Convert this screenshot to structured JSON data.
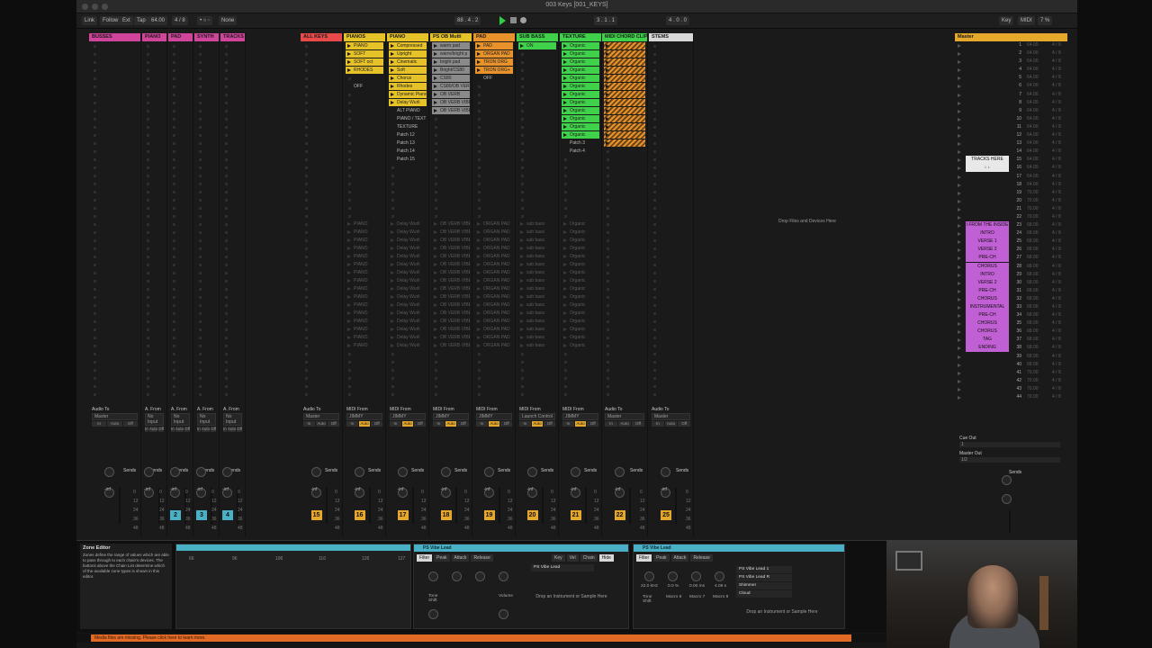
{
  "window": {
    "title": "003 Keys  [001_KEYS]"
  },
  "controlbar": {
    "left_items": [
      "Link",
      "Follow",
      "Ext",
      "Tap",
      "64.00",
      "4 / 8",
      "• ○ ◦",
      "None"
    ],
    "position": "88 . 4 . 2",
    "loop_start": "3 . 1 . 1",
    "loop_len": "4 . 0 . 0",
    "right_items": [
      "Key",
      "MIDI",
      "7 %"
    ]
  },
  "tracks": [
    {
      "name": "BUSSES",
      "color": "#d1449c",
      "num": "",
      "io_label": "Audio To",
      "io_value": "Master",
      "clips": []
    },
    {
      "name": "PIANO",
      "color": "#d1449c",
      "num": "",
      "io_label": "A. From",
      "io_value": "No Input",
      "clips": []
    },
    {
      "name": "PAD",
      "color": "#d1449c",
      "num": "2",
      "io_label": "A. From",
      "io_value": "No Input",
      "clips": []
    },
    {
      "name": "SYNTH",
      "color": "#d1449c",
      "num": "3",
      "io_label": "A. From",
      "io_value": "No Input",
      "clips": []
    },
    {
      "name": "TRACKS",
      "color": "#d1449c",
      "num": "4",
      "io_label": "A. From",
      "io_value": "No Input",
      "clips": []
    },
    {
      "name": "ALL KEYS",
      "color": "#e84a4a",
      "num": "15",
      "io_label": "Audio To",
      "io_value": "Master",
      "clips": []
    },
    {
      "name": "PIANOS",
      "color": "#e6c229",
      "num": "16",
      "io_label": "MIDI From",
      "io_value": "JIMMY",
      "clips": [
        "PIANO",
        "SOFT",
        "SOFT oct",
        "RHODES",
        "",
        "OFF"
      ]
    },
    {
      "name": "PIANO",
      "color": "#e6c229",
      "num": "17",
      "io_label": "MIDI From",
      "io_value": "JIMMY",
      "clips": [
        "Compressed",
        "Upright",
        "Cinematic",
        "Soft",
        "Chorus",
        "Rhodes",
        "Dynamic Piano",
        "Delay Wurli",
        "ALT PIANO",
        "PIANO / TEXT",
        "TEXTURE",
        "Patch 12",
        "Patch 13",
        "Patch 14",
        "Patch 15"
      ]
    },
    {
      "name": "PS OB Multi",
      "color": "#e6c229",
      "num": "18",
      "io_label": "MIDI From",
      "io_value": "JIMMY",
      "clips": [
        "warm pad",
        "warm/bright p",
        "bright pad",
        "Bright/CS80",
        "CS80",
        "CS80/OB VERB",
        "OB VERB",
        "OB VERB VIBE L",
        "OB VERB VIBE L"
      ]
    },
    {
      "name": "PAD",
      "color": "#e8922b",
      "num": "19",
      "io_label": "MIDI From",
      "io_value": "JIMMY",
      "clips": [
        "PAD",
        "ORGAN PAD",
        "TRON ORG",
        "TRON ORG+",
        "OFF"
      ]
    },
    {
      "name": "SUB BASS",
      "color": "#3fd14a",
      "num": "20",
      "io_label": "MIDI From",
      "io_value": "Launch Control",
      "clips": [
        "ON"
      ]
    },
    {
      "name": "TEXTURE",
      "color": "#3fd14a",
      "num": "21",
      "io_label": "MIDI From",
      "io_value": "JIMMY",
      "clips": [
        "Organic",
        "Organic",
        "Organic",
        "Organic",
        "Organic",
        "Organic",
        "Organic",
        "Organic",
        "Organic",
        "Organic",
        "Organic",
        "Organic",
        "Patch 3",
        "Patch 4"
      ]
    },
    {
      "name": "MIDI CHORD CLIPS",
      "color": "#3fd14a",
      "num": "22",
      "io_label": "Audio To",
      "io_value": "Master",
      "clips": [
        "",
        "",
        "",
        "",
        "",
        "",
        "",
        "",
        "",
        "",
        "",
        "",
        ""
      ]
    },
    {
      "name": "STEMS",
      "color": "#d7d7d7",
      "num": "25",
      "io_label": "Audio To",
      "io_value": "Master",
      "clips": []
    }
  ],
  "ghost_clips": [
    "PIANO",
    "Delay Wurli",
    "OB VERB VIBE L",
    "ORGAN PAD",
    "sub bass",
    "Organic"
  ],
  "master": {
    "header": "Master",
    "scenes": [
      {
        "name": "",
        "num": "1",
        "tempo": "64.00",
        "sig": "4 / 8"
      },
      {
        "name": "",
        "num": "2",
        "tempo": "64.00",
        "sig": "4 / 8"
      },
      {
        "name": "",
        "num": "3",
        "tempo": "64.00",
        "sig": "4 / 8"
      },
      {
        "name": "",
        "num": "4",
        "tempo": "64.00",
        "sig": "4 / 8"
      },
      {
        "name": "",
        "num": "5",
        "tempo": "64.00",
        "sig": "4 / 8"
      },
      {
        "name": "",
        "num": "6",
        "tempo": "64.00",
        "sig": "4 / 8"
      },
      {
        "name": "",
        "num": "7",
        "tempo": "64.00",
        "sig": "4 / 8"
      },
      {
        "name": "",
        "num": "8",
        "tempo": "64.00",
        "sig": "4 / 8"
      },
      {
        "name": "",
        "num": "9",
        "tempo": "64.00",
        "sig": "4 / 8"
      },
      {
        "name": "",
        "num": "10",
        "tempo": "64.00",
        "sig": "4 / 8"
      },
      {
        "name": "",
        "num": "11",
        "tempo": "64.00",
        "sig": "4 / 8"
      },
      {
        "name": "",
        "num": "12",
        "tempo": "64.00",
        "sig": "4 / 8"
      },
      {
        "name": "",
        "num": "13",
        "tempo": "64.00",
        "sig": "4 / 8"
      },
      {
        "name": "",
        "num": "14",
        "tempo": "64.00",
        "sig": "4 / 8"
      },
      {
        "name": "TRACKS HERE",
        "num": "15",
        "tempo": "64.00",
        "sig": "4 / 8"
      },
      {
        "name": "↓ ↓",
        "num": "16",
        "tempo": "64.00",
        "sig": "4 / 8"
      },
      {
        "name": "",
        "num": "17",
        "tempo": "64.00",
        "sig": "4 / 8"
      },
      {
        "name": "",
        "num": "18",
        "tempo": "64.00",
        "sig": "4 / 8"
      },
      {
        "name": "",
        "num": "19",
        "tempo": "70.00",
        "sig": "4 / 8"
      },
      {
        "name": "",
        "num": "20",
        "tempo": "70.00",
        "sig": "4 / 8"
      },
      {
        "name": "",
        "num": "21",
        "tempo": "70.00",
        "sig": "4 / 8"
      },
      {
        "name": "",
        "num": "22",
        "tempo": "70.00",
        "sig": "4 / 8"
      },
      {
        "name": "I FROM THE INSIDE O",
        "num": "23",
        "tempo": "68.00",
        "sig": "4 / 8"
      },
      {
        "name": "INTRO",
        "num": "24",
        "tempo": "68.00",
        "sig": "4 / 8"
      },
      {
        "name": "VERSE 1",
        "num": "25",
        "tempo": "68.00",
        "sig": "4 / 8"
      },
      {
        "name": "VERSE 2",
        "num": "26",
        "tempo": "68.00",
        "sig": "4 / 8"
      },
      {
        "name": "PRE-CH",
        "num": "27",
        "tempo": "68.00",
        "sig": "4 / 8"
      },
      {
        "name": "CHORUS",
        "num": "28",
        "tempo": "68.00",
        "sig": "4 / 8"
      },
      {
        "name": "INTRO",
        "num": "29",
        "tempo": "68.00",
        "sig": "4 / 8"
      },
      {
        "name": "VERSE 2",
        "num": "30",
        "tempo": "68.00",
        "sig": "4 / 8"
      },
      {
        "name": "PRE-CH",
        "num": "31",
        "tempo": "68.00",
        "sig": "4 / 8"
      },
      {
        "name": "CHORUS",
        "num": "32",
        "tempo": "68.00",
        "sig": "4 / 8"
      },
      {
        "name": "INSTRUMENTAL",
        "num": "33",
        "tempo": "68.00",
        "sig": "4 / 8"
      },
      {
        "name": "PRE-CH",
        "num": "34",
        "tempo": "68.00",
        "sig": "4 / 8"
      },
      {
        "name": "CHORUS",
        "num": "35",
        "tempo": "68.00",
        "sig": "4 / 8"
      },
      {
        "name": "CHORUS",
        "num": "36",
        "tempo": "68.00",
        "sig": "4 / 8"
      },
      {
        "name": "TAG",
        "num": "37",
        "tempo": "68.00",
        "sig": "4 / 8"
      },
      {
        "name": "ENDING",
        "num": "38",
        "tempo": "68.00",
        "sig": "4 / 8"
      },
      {
        "name": "",
        "num": "39",
        "tempo": "68.00",
        "sig": "4 / 8"
      },
      {
        "name": "",
        "num": "40",
        "tempo": "68.00",
        "sig": "4 / 8"
      },
      {
        "name": "",
        "num": "41",
        "tempo": "70.00",
        "sig": "4 / 8"
      },
      {
        "name": "",
        "num": "42",
        "tempo": "70.00",
        "sig": "4 / 8"
      },
      {
        "name": "",
        "num": "43",
        "tempo": "70.00",
        "sig": "4 / 8"
      },
      {
        "name": "",
        "num": "44",
        "tempo": "70.00",
        "sig": "4 / 8"
      }
    ],
    "cue_out_label": "Cue Out",
    "cue_out_value": "1",
    "master_out_label": "Master Out",
    "master_out_value": "1/2",
    "sends": "Sends"
  },
  "drop_hint": "Drop Files and Devices Here",
  "sends_label": "Sends",
  "fader_value": "-inf",
  "zone_editor": {
    "title": "Zone Editor",
    "text": "Zones define the range of values which are able to pass through to each chain's devices. The buttons above the Chain List determine which of the available zone types is shown in this editor.",
    "ruler": [
      "66",
      "96",
      "106",
      "116",
      "126",
      "127"
    ]
  },
  "device1": {
    "title": "PS Vibe Lead",
    "tabs": [
      "Filter",
      "Peak",
      "Attack",
      "Release"
    ],
    "chain": "PS Vibe Lead",
    "tabs2": [
      "Key",
      "Vel",
      "Chain",
      "Hide"
    ],
    "macros": [
      "Tone Shift",
      "Volume"
    ],
    "drop": "Drop an Instrument or Sample Here"
  },
  "device2": {
    "title": "PS Vibe Lead",
    "tabs": [
      "Filter",
      "Peak",
      "Attack",
      "Release"
    ],
    "chains": [
      "PS Vibe Lead 1",
      "PS Vibe Lead R",
      "Shimmer",
      "Cloud"
    ],
    "values": [
      "22.0 kHz",
      "0.0 %",
      "0.00 ms",
      "4.09 s"
    ],
    "macros": [
      "Tone Shift",
      "Macro 6",
      "Macro 7",
      "Macro 8"
    ],
    "drop": "Drop an Instrument or Sample Here"
  },
  "status_message": "Media files are missing. Please click here to learn more."
}
